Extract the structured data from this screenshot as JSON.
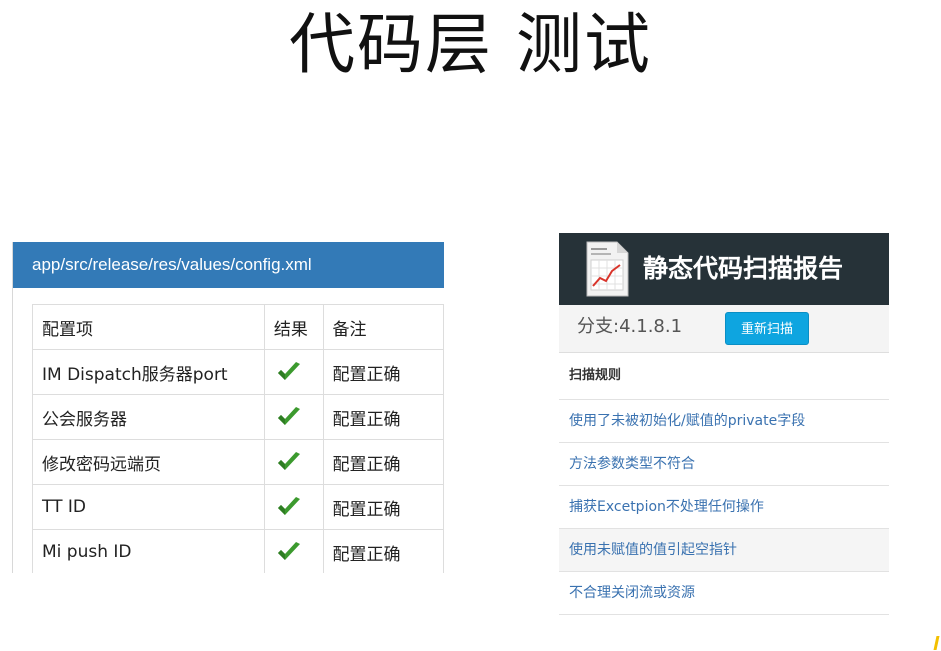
{
  "slide": {
    "title": "代码层 测试"
  },
  "config_panel": {
    "path": "app/src/release/res/values/config.xml",
    "columns": [
      "配置项",
      "结果",
      "备注"
    ],
    "rows": [
      {
        "item": "IM Dispatch服务器port",
        "result_icon": "checkmark-icon",
        "note": "配置正确"
      },
      {
        "item": "公会服务器",
        "result_icon": "checkmark-icon",
        "note": "配置正确"
      },
      {
        "item": "修改密码远端页",
        "result_icon": "checkmark-icon",
        "note": "配置正确"
      },
      {
        "item": "TT ID",
        "result_icon": "checkmark-icon",
        "note": "配置正确"
      },
      {
        "item": "Mi push ID",
        "result_icon": "checkmark-icon",
        "note": "配置正确"
      }
    ],
    "header_color": "#337ab7",
    "check_color": "#3c9a2e"
  },
  "scan_panel": {
    "title": "静态代码扫描报告",
    "header_icon": "report-document-icon",
    "branch": "分支:4.1.8.1",
    "rescan_label": "重新扫描",
    "rules_heading": "扫描规则",
    "rules": [
      "使用了未被初始化/赋值的private字段",
      "方法参数类型不符合",
      "捕获Excetpion不处理任何操作",
      "使用未赋值的值引起空指针",
      "不合理关闭流或资源"
    ],
    "header_color": "#263238",
    "button_color": "#0ea5e0",
    "link_color": "#3a72b0"
  }
}
